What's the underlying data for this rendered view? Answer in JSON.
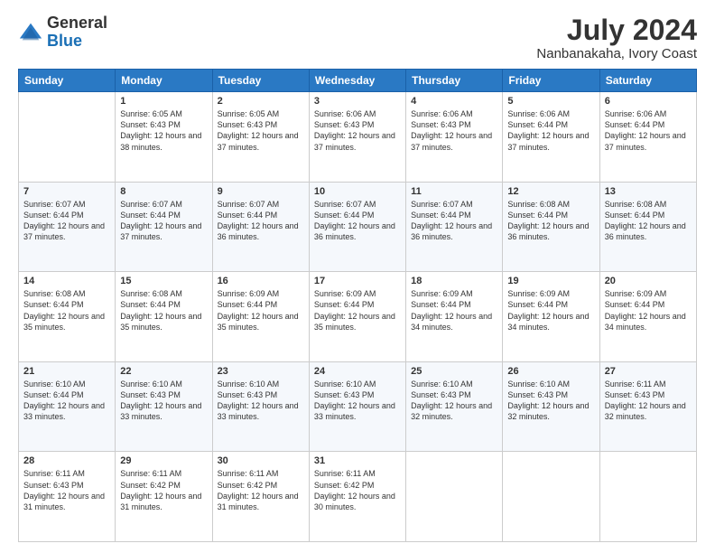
{
  "header": {
    "logo_general": "General",
    "logo_blue": "Blue",
    "month_year": "July 2024",
    "location": "Nanbanakaha, Ivory Coast"
  },
  "days_of_week": [
    "Sunday",
    "Monday",
    "Tuesday",
    "Wednesday",
    "Thursday",
    "Friday",
    "Saturday"
  ],
  "weeks": [
    [
      {
        "day": "",
        "sunrise": "",
        "sunset": "",
        "daylight": ""
      },
      {
        "day": "1",
        "sunrise": "Sunrise: 6:05 AM",
        "sunset": "Sunset: 6:43 PM",
        "daylight": "Daylight: 12 hours and 38 minutes."
      },
      {
        "day": "2",
        "sunrise": "Sunrise: 6:05 AM",
        "sunset": "Sunset: 6:43 PM",
        "daylight": "Daylight: 12 hours and 37 minutes."
      },
      {
        "day": "3",
        "sunrise": "Sunrise: 6:06 AM",
        "sunset": "Sunset: 6:43 PM",
        "daylight": "Daylight: 12 hours and 37 minutes."
      },
      {
        "day": "4",
        "sunrise": "Sunrise: 6:06 AM",
        "sunset": "Sunset: 6:43 PM",
        "daylight": "Daylight: 12 hours and 37 minutes."
      },
      {
        "day": "5",
        "sunrise": "Sunrise: 6:06 AM",
        "sunset": "Sunset: 6:44 PM",
        "daylight": "Daylight: 12 hours and 37 minutes."
      },
      {
        "day": "6",
        "sunrise": "Sunrise: 6:06 AM",
        "sunset": "Sunset: 6:44 PM",
        "daylight": "Daylight: 12 hours and 37 minutes."
      }
    ],
    [
      {
        "day": "7",
        "sunrise": "Sunrise: 6:07 AM",
        "sunset": "Sunset: 6:44 PM",
        "daylight": "Daylight: 12 hours and 37 minutes."
      },
      {
        "day": "8",
        "sunrise": "Sunrise: 6:07 AM",
        "sunset": "Sunset: 6:44 PM",
        "daylight": "Daylight: 12 hours and 37 minutes."
      },
      {
        "day": "9",
        "sunrise": "Sunrise: 6:07 AM",
        "sunset": "Sunset: 6:44 PM",
        "daylight": "Daylight: 12 hours and 36 minutes."
      },
      {
        "day": "10",
        "sunrise": "Sunrise: 6:07 AM",
        "sunset": "Sunset: 6:44 PM",
        "daylight": "Daylight: 12 hours and 36 minutes."
      },
      {
        "day": "11",
        "sunrise": "Sunrise: 6:07 AM",
        "sunset": "Sunset: 6:44 PM",
        "daylight": "Daylight: 12 hours and 36 minutes."
      },
      {
        "day": "12",
        "sunrise": "Sunrise: 6:08 AM",
        "sunset": "Sunset: 6:44 PM",
        "daylight": "Daylight: 12 hours and 36 minutes."
      },
      {
        "day": "13",
        "sunrise": "Sunrise: 6:08 AM",
        "sunset": "Sunset: 6:44 PM",
        "daylight": "Daylight: 12 hours and 36 minutes."
      }
    ],
    [
      {
        "day": "14",
        "sunrise": "Sunrise: 6:08 AM",
        "sunset": "Sunset: 6:44 PM",
        "daylight": "Daylight: 12 hours and 35 minutes."
      },
      {
        "day": "15",
        "sunrise": "Sunrise: 6:08 AM",
        "sunset": "Sunset: 6:44 PM",
        "daylight": "Daylight: 12 hours and 35 minutes."
      },
      {
        "day": "16",
        "sunrise": "Sunrise: 6:09 AM",
        "sunset": "Sunset: 6:44 PM",
        "daylight": "Daylight: 12 hours and 35 minutes."
      },
      {
        "day": "17",
        "sunrise": "Sunrise: 6:09 AM",
        "sunset": "Sunset: 6:44 PM",
        "daylight": "Daylight: 12 hours and 35 minutes."
      },
      {
        "day": "18",
        "sunrise": "Sunrise: 6:09 AM",
        "sunset": "Sunset: 6:44 PM",
        "daylight": "Daylight: 12 hours and 34 minutes."
      },
      {
        "day": "19",
        "sunrise": "Sunrise: 6:09 AM",
        "sunset": "Sunset: 6:44 PM",
        "daylight": "Daylight: 12 hours and 34 minutes."
      },
      {
        "day": "20",
        "sunrise": "Sunrise: 6:09 AM",
        "sunset": "Sunset: 6:44 PM",
        "daylight": "Daylight: 12 hours and 34 minutes."
      }
    ],
    [
      {
        "day": "21",
        "sunrise": "Sunrise: 6:10 AM",
        "sunset": "Sunset: 6:44 PM",
        "daylight": "Daylight: 12 hours and 33 minutes."
      },
      {
        "day": "22",
        "sunrise": "Sunrise: 6:10 AM",
        "sunset": "Sunset: 6:43 PM",
        "daylight": "Daylight: 12 hours and 33 minutes."
      },
      {
        "day": "23",
        "sunrise": "Sunrise: 6:10 AM",
        "sunset": "Sunset: 6:43 PM",
        "daylight": "Daylight: 12 hours and 33 minutes."
      },
      {
        "day": "24",
        "sunrise": "Sunrise: 6:10 AM",
        "sunset": "Sunset: 6:43 PM",
        "daylight": "Daylight: 12 hours and 33 minutes."
      },
      {
        "day": "25",
        "sunrise": "Sunrise: 6:10 AM",
        "sunset": "Sunset: 6:43 PM",
        "daylight": "Daylight: 12 hours and 32 minutes."
      },
      {
        "day": "26",
        "sunrise": "Sunrise: 6:10 AM",
        "sunset": "Sunset: 6:43 PM",
        "daylight": "Daylight: 12 hours and 32 minutes."
      },
      {
        "day": "27",
        "sunrise": "Sunrise: 6:11 AM",
        "sunset": "Sunset: 6:43 PM",
        "daylight": "Daylight: 12 hours and 32 minutes."
      }
    ],
    [
      {
        "day": "28",
        "sunrise": "Sunrise: 6:11 AM",
        "sunset": "Sunset: 6:43 PM",
        "daylight": "Daylight: 12 hours and 31 minutes."
      },
      {
        "day": "29",
        "sunrise": "Sunrise: 6:11 AM",
        "sunset": "Sunset: 6:42 PM",
        "daylight": "Daylight: 12 hours and 31 minutes."
      },
      {
        "day": "30",
        "sunrise": "Sunrise: 6:11 AM",
        "sunset": "Sunset: 6:42 PM",
        "daylight": "Daylight: 12 hours and 31 minutes."
      },
      {
        "day": "31",
        "sunrise": "Sunrise: 6:11 AM",
        "sunset": "Sunset: 6:42 PM",
        "daylight": "Daylight: 12 hours and 30 minutes."
      },
      {
        "day": "",
        "sunrise": "",
        "sunset": "",
        "daylight": ""
      },
      {
        "day": "",
        "sunrise": "",
        "sunset": "",
        "daylight": ""
      },
      {
        "day": "",
        "sunrise": "",
        "sunset": "",
        "daylight": ""
      }
    ]
  ]
}
